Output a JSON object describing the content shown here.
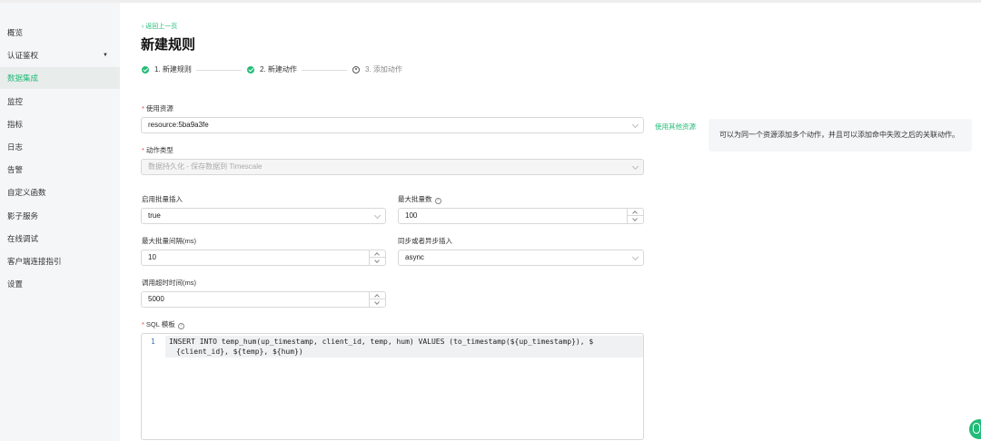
{
  "sidebar": {
    "items": [
      {
        "label": "概览"
      },
      {
        "label": "认证鉴权"
      },
      {
        "label": "数据集成"
      },
      {
        "label": "监控"
      },
      {
        "label": "指标"
      },
      {
        "label": "日志"
      },
      {
        "label": "告警"
      },
      {
        "label": "自定义函数"
      },
      {
        "label": "影子服务"
      },
      {
        "label": "在线调试"
      },
      {
        "label": "客户端连接指引"
      },
      {
        "label": "设置"
      }
    ],
    "active_item": "数据集成"
  },
  "header": {
    "back_label": "返回上一页",
    "title": "新建规则"
  },
  "steps": [
    {
      "label": "1. 新建规则",
      "state": "done"
    },
    {
      "label": "2. 新建动作",
      "state": "done"
    },
    {
      "label": "3. 添加动作",
      "state": "pending"
    }
  ],
  "form": {
    "resource": {
      "label": "使用资源",
      "value": "resource:5ba9a3fe",
      "link": "使用其他资源"
    },
    "action_type": {
      "label": "动作类型",
      "value": "数据持久化 - 保存数据到 Timescale"
    },
    "batch_insert": {
      "label": "启用批量插入",
      "value": "true"
    },
    "max_batch": {
      "label": "最大批量数",
      "value": "100"
    },
    "max_batch_interval": {
      "label": "最大批量间隔(ms)",
      "value": "10"
    },
    "sync_mode": {
      "label": "同步或者异步插入",
      "value": "async"
    },
    "timeout": {
      "label": "调用超时时间(ms)",
      "value": "5000"
    },
    "sql": {
      "label": "SQL 模板",
      "line_number": "1",
      "line1": "INSERT INTO temp_hum(up_timestamp, client_id, temp, hum) VALUES (to_timestamp(${up_timestamp}), $",
      "line2": "{client_id}, ${temp}, ${hum})"
    }
  },
  "tip": "可以为同一个资源添加多个动作，并且可以添加命中失败之后的关联动作。",
  "help_glyph": "?",
  "colors": {
    "accent": "#22bb77",
    "required": "#e5484d"
  }
}
